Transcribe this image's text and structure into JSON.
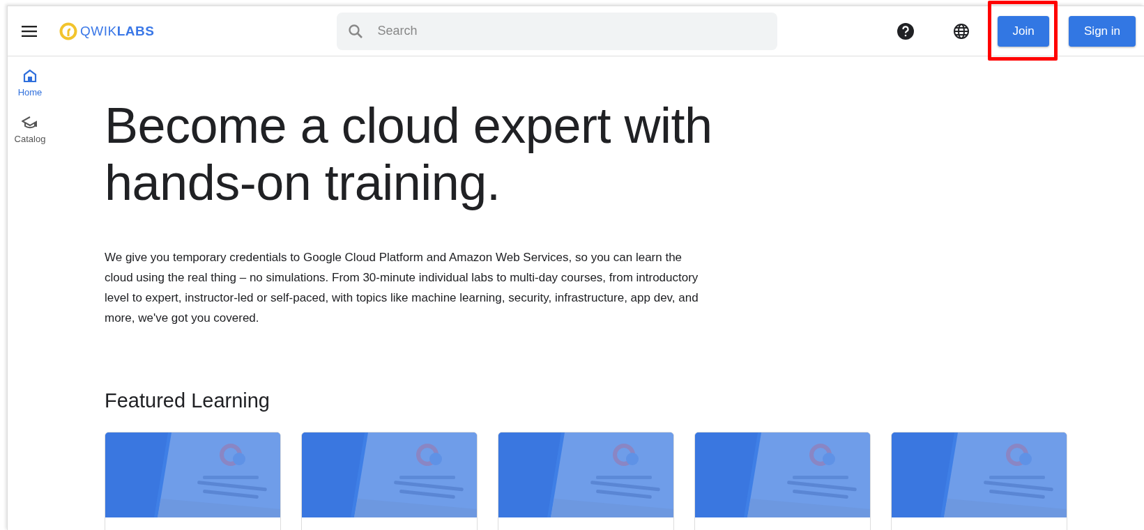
{
  "header": {
    "logo": {
      "light": "QWIK",
      "bold": "LABS"
    },
    "search": {
      "placeholder": "Search"
    },
    "buttons": [
      {
        "label": "Join",
        "highlighted": true
      },
      {
        "label": "Sign in",
        "highlighted": false
      }
    ]
  },
  "sidebar": {
    "items": [
      {
        "label": "Home",
        "kind": "home",
        "selected": true
      },
      {
        "label": "Catalog",
        "kind": "catalog",
        "selected": false
      }
    ]
  },
  "hero": {
    "title": "Become a cloud expert with hands-on training.",
    "description": "We give you temporary credentials to Google Cloud Platform and Amazon Web Services, so you can learn the cloud using the real thing – no simulations. From 30-minute individual labs to multi-day courses, from introductory level to expert, instructor-led or self-paced, with topics like machine learning, security, infrastructure, app dev, and more, we've got you covered."
  },
  "featured": {
    "title": "Featured Learning"
  }
}
